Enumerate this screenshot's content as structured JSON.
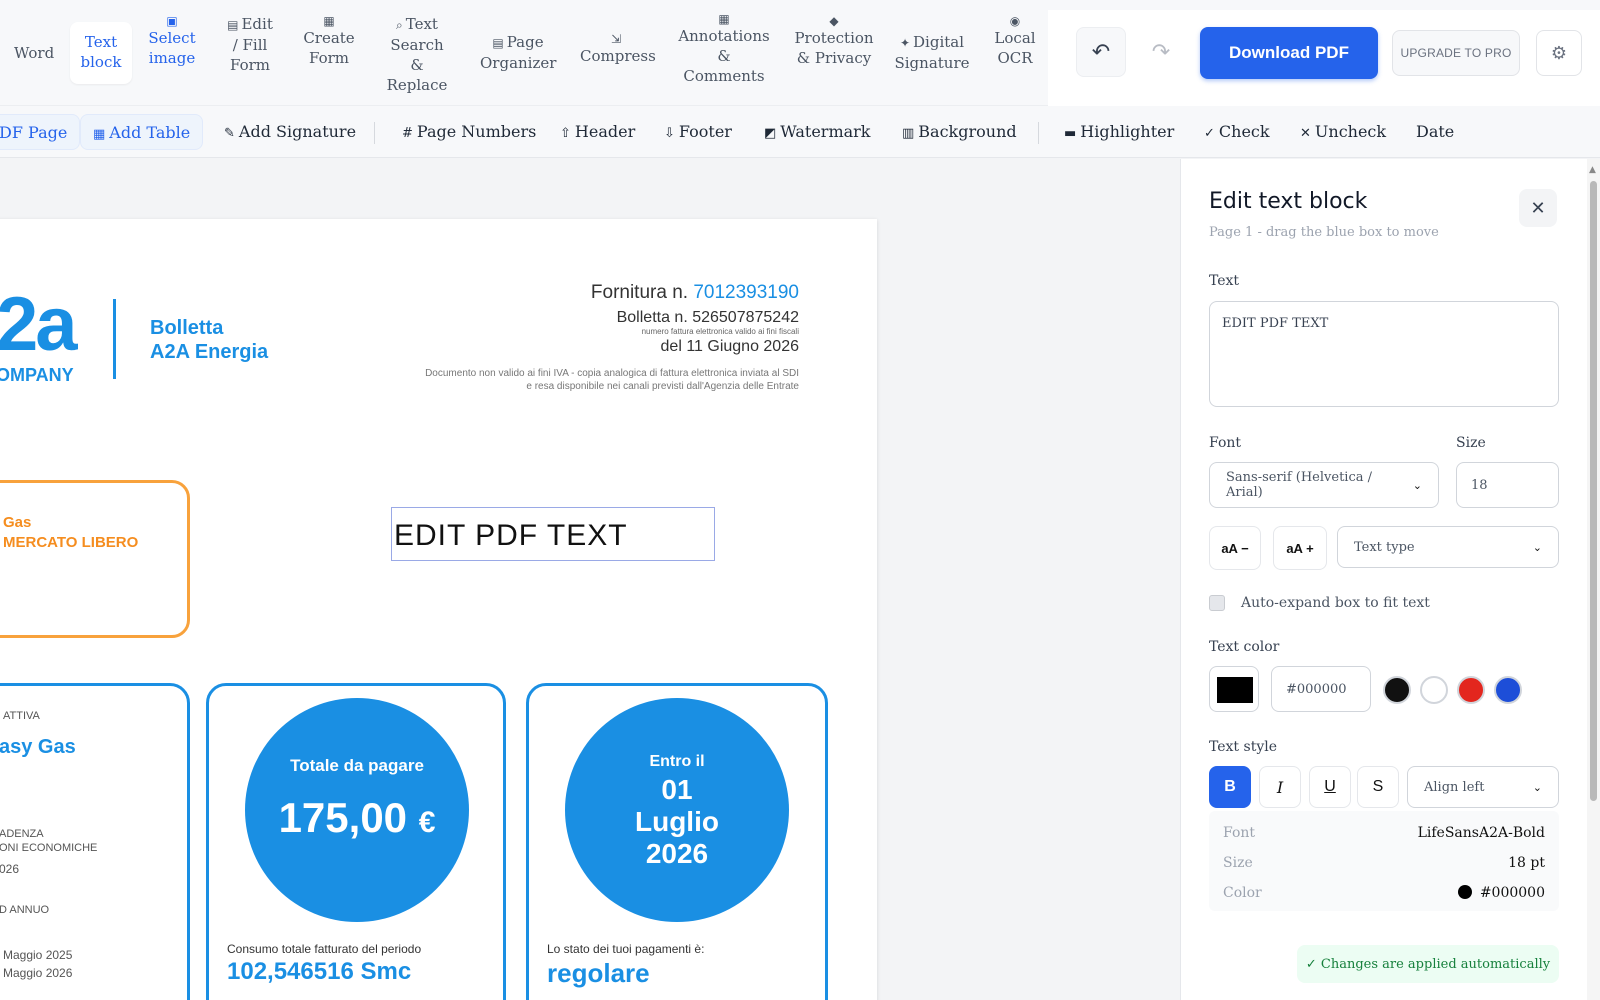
{
  "toolbar": {
    "tools": [
      {
        "label": "Word"
      },
      {
        "label": "Text block",
        "icon": "text-icon"
      },
      {
        "label": "Select image",
        "icon": "image-icon"
      },
      {
        "label": "Edit / Fill Form",
        "icon": "form-icon"
      },
      {
        "label": "Create Form",
        "icon": "create-form-icon"
      },
      {
        "label": "Text Search & Replace",
        "icon": "search-icon"
      },
      {
        "label": "Page Organizer",
        "icon": "organizer-icon"
      },
      {
        "label": "Compress",
        "icon": "compress-icon"
      },
      {
        "label": "Annotations & Comments",
        "icon": "annotation-icon"
      },
      {
        "label": "Protection & Privacy",
        "icon": "shield-icon"
      },
      {
        "label": "Digital Signature",
        "icon": "signature-icon"
      },
      {
        "label": "Local OCR",
        "icon": "ocr-icon"
      }
    ],
    "undo": "↶",
    "redo": "↷",
    "download_label": "Download PDF",
    "upgrade_label": "UPGRADE TO PRO",
    "settings_icon": "⚙"
  },
  "toolbar2": {
    "items": [
      {
        "label": "DF Page"
      },
      {
        "label": "Add Table"
      },
      {
        "label": "Add Signature"
      },
      {
        "label": "Page Numbers"
      },
      {
        "label": "Header"
      },
      {
        "label": "Footer"
      },
      {
        "label": "Watermark"
      },
      {
        "label": "Background"
      },
      {
        "label": "Highlighter"
      },
      {
        "label": "Check"
      },
      {
        "label": "Uncheck"
      },
      {
        "label": "Date"
      }
    ]
  },
  "document": {
    "logo_text": "2a",
    "logo_company": "OMPANY",
    "bolletta_line1": "Bolletta",
    "bolletta_line2": "A2A Energia",
    "fornitura_prefix": "Fornitura n.",
    "fornitura_number": "7012393190",
    "bolletta_number": "Bolletta n. 526507875242",
    "bolletta_sub": "numero fattura elettronica valido ai fini fiscali",
    "bolletta_date": "del 11 Giugno 2026",
    "disclaimer_line1": "Documento non valido ai fini IVA - copia analogica di fattura elettronica inviata al SDI",
    "disclaimer_line2": "e resa disponibile nei canali previsti dall'Agenzia delle Entrate",
    "gas_label": "Gas",
    "mercato_label": "MERCATO LIBERO",
    "edit_text": "EDIT PDF TEXT",
    "card_left": {
      "attiva": "ATTIVA",
      "offer": "asy Gas",
      "line1": "ADENZA",
      "line2": "ONI ECONOMICHE",
      "line3": "026",
      "line4": "D ANNUO",
      "line5": "Maggio 2025",
      "line6": "Maggio 2026"
    },
    "card_total": {
      "label": "Totale da pagare",
      "amount": "175,00",
      "currency": "€",
      "footer": "Consumo totale fatturato del periodo",
      "consumption": "102,546516 Smc"
    },
    "card_due": {
      "line1": "Entro il",
      "line2": "01",
      "line3": "Luglio",
      "line4": "2026",
      "footer": "Lo stato dei tuoi pagamenti è:",
      "status": "regolare"
    }
  },
  "panel": {
    "title": "Edit text block",
    "subtitle": "Page 1 - drag the blue box to move",
    "text_label": "Text",
    "text_value": "EDIT PDF TEXT",
    "font_label": "Font",
    "font_value": "Sans-serif (Helvetica / Arial)",
    "size_label": "Size",
    "size_value": "18",
    "decrease_label": "aA −",
    "increase_label": "aA +",
    "text_type_placeholder": "Text type",
    "auto_expand_label": "Auto-expand box to fit text",
    "color_label": "Text color",
    "color_value": "#000000",
    "preset_colors": [
      "#111111",
      "#ffffff",
      "#e3261e",
      "#1d4ed8"
    ],
    "style_label": "Text style",
    "bold": "B",
    "italic": "I",
    "underline": "U",
    "strike": "S",
    "align_value": "Align left",
    "info": {
      "font_key": "Font",
      "font_val": "LifeSansA2A-Bold",
      "size_key": "Size",
      "size_val": "18 pt",
      "color_key": "Color",
      "color_val": "#000000"
    },
    "applied_text": "✓  Changes are applied automatically"
  },
  "colors": {
    "accent": "#2563eb",
    "brand": "#1a8fe3",
    "orange": "#f8a23c"
  }
}
